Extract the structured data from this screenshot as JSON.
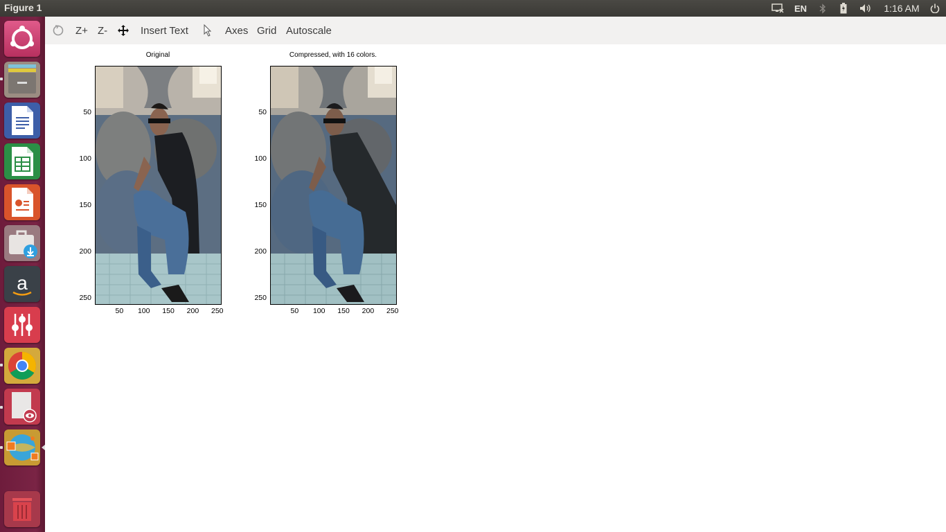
{
  "window": {
    "title": "Figure 1"
  },
  "tray": {
    "language": "EN",
    "clock": "1:16 AM"
  },
  "launcher": {
    "items": [
      {
        "icon": "ubuntu-dash-icon"
      },
      {
        "icon": "files-icon"
      },
      {
        "icon": "libreoffice-writer-icon"
      },
      {
        "icon": "libreoffice-calc-icon"
      },
      {
        "icon": "libreoffice-impress-icon"
      },
      {
        "icon": "software-center-icon"
      },
      {
        "icon": "amazon-icon"
      },
      {
        "icon": "mixer-icon"
      },
      {
        "icon": "chrome-icon"
      },
      {
        "icon": "document-viewer-icon"
      },
      {
        "icon": "ffmpeg-icon"
      },
      {
        "icon": "trash-icon"
      }
    ]
  },
  "toolbar": {
    "zoom_in": "Z+",
    "zoom_out": "Z-",
    "insert_text": "Insert Text",
    "axes": "Axes",
    "grid": "Grid",
    "autoscale": "Autoscale"
  },
  "chart_data": [
    {
      "type": "image",
      "title": "Original",
      "xticks": [
        "50",
        "100",
        "150",
        "200",
        "250"
      ],
      "yticks": [
        "50",
        "100",
        "150",
        "200",
        "250"
      ],
      "xlim": [
        0,
        256
      ],
      "ylim": [
        256,
        0
      ]
    },
    {
      "type": "image",
      "title": "Compressed, with 16 colors.",
      "xticks": [
        "50",
        "100",
        "150",
        "200",
        "250"
      ],
      "yticks": [
        "50",
        "100",
        "150",
        "200",
        "250"
      ],
      "xlim": [
        0,
        256
      ],
      "ylim": [
        256,
        0
      ]
    }
  ]
}
